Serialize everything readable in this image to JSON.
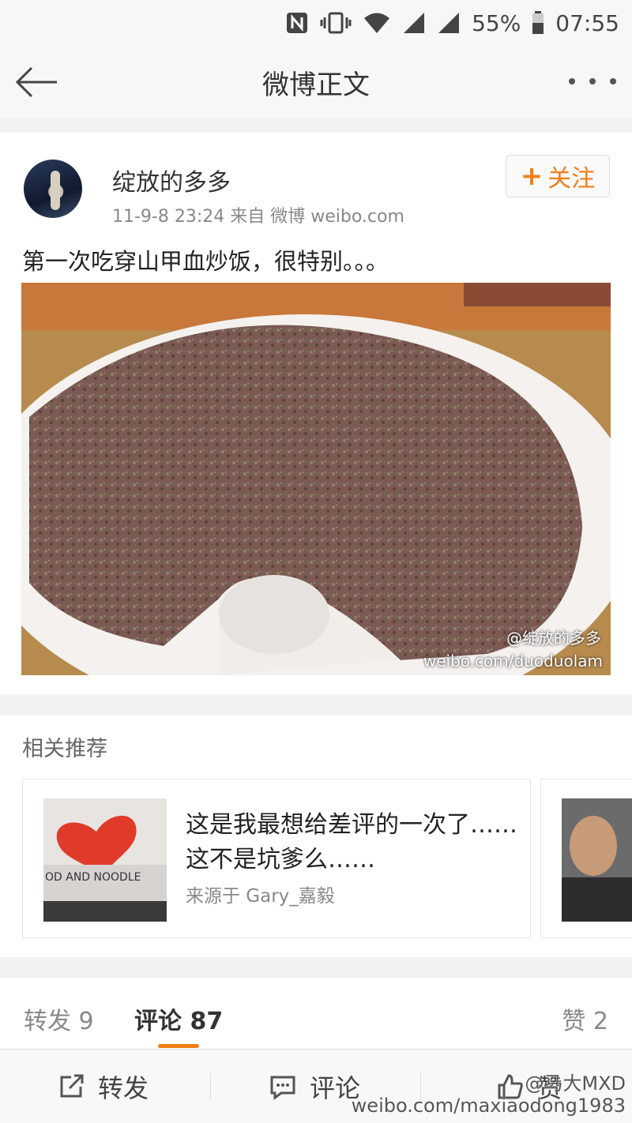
{
  "status_bar": {
    "battery": "55%",
    "time": "07:55"
  },
  "header": {
    "title": "微博正文"
  },
  "post": {
    "username": "绽放的多多",
    "meta": "11-9-8 23:24   来自 微博 weibo.com",
    "follow_label": "关注",
    "text": "第一次吃穿山甲血炒饭，很特别。。。",
    "image_watermark_name": "@绽放的多多",
    "image_watermark_url": "weibo.com/duoduolam"
  },
  "recommend": {
    "section_title": "相关推荐",
    "items": [
      {
        "title": "这是我最想给差评的一次了……这不是坑爹么……",
        "source": "来源于 Gary_嘉毅",
        "thumb_text": "OD AND NOODLE"
      }
    ]
  },
  "tabs": {
    "repost": "转发 9",
    "comment": "评论 87",
    "like": "赞 2"
  },
  "bottom_bar": {
    "repost": "转发",
    "comment": "评论",
    "like": "赞"
  },
  "bottom_watermark": {
    "name": "@马大MXD",
    "url": "weibo.com/maxiaodong1983"
  },
  "icons": {
    "nfc": "nfc-icon",
    "vibrate": "vibrate-icon",
    "wifi": "wifi-icon",
    "signal": "signal-icon",
    "battery": "battery-icon",
    "back": "back-arrow-icon",
    "more": "more-icon",
    "repost": "repost-icon",
    "comment": "comment-icon",
    "like": "like-icon"
  },
  "colors": {
    "accent": "#f37d16"
  }
}
